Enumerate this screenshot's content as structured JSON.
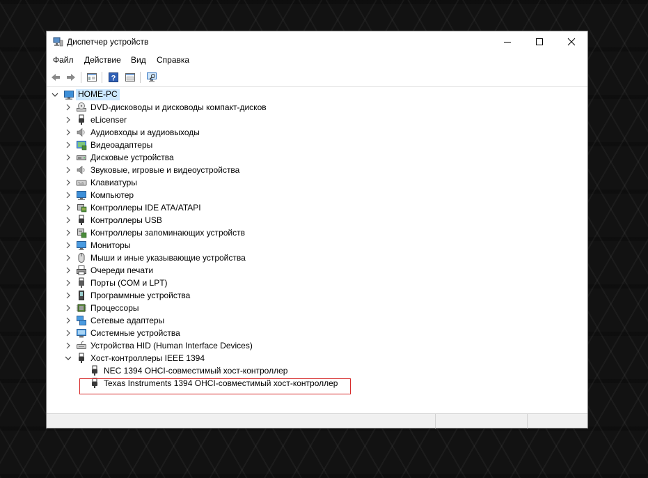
{
  "window": {
    "title": "Диспетчер устройств",
    "icon": "device-manager-icon"
  },
  "menu": [
    "Файл",
    "Действие",
    "Вид",
    "Справка"
  ],
  "toolbar": {
    "buttons": [
      "back-arrow-icon",
      "forward-arrow-icon",
      "properties-view-icon",
      "help-icon",
      "show-hide-panel-icon",
      "scan-hardware-icon"
    ]
  },
  "tree": {
    "root": "HOME-PC",
    "categories": [
      {
        "label": "DVD-дисководы и дисководы компакт-дисков",
        "icon": "optical-drive-icon"
      },
      {
        "label": "eLicenser",
        "icon": "usb-plug-icon"
      },
      {
        "label": "Аудиовходы и аудиовыходы",
        "icon": "speaker-icon"
      },
      {
        "label": "Видеоадаптеры",
        "icon": "display-adapter-icon"
      },
      {
        "label": "Дисковые устройства",
        "icon": "disk-drive-icon"
      },
      {
        "label": "Звуковые, игровые и видеоустройства",
        "icon": "speaker-icon"
      },
      {
        "label": "Клавиатуры",
        "icon": "keyboard-icon"
      },
      {
        "label": "Компьютер",
        "icon": "computer-icon"
      },
      {
        "label": "Контроллеры IDE ATA/ATAPI",
        "icon": "ide-controller-icon"
      },
      {
        "label": "Контроллеры USB",
        "icon": "usb-plug-icon"
      },
      {
        "label": "Контроллеры запоминающих устройств",
        "icon": "storage-controller-icon"
      },
      {
        "label": "Мониторы",
        "icon": "monitor-icon"
      },
      {
        "label": "Мыши и иные указывающие устройства",
        "icon": "mouse-icon"
      },
      {
        "label": "Очереди печати",
        "icon": "printer-icon"
      },
      {
        "label": "Порты (COM и LPT)",
        "icon": "port-icon"
      },
      {
        "label": "Программные устройства",
        "icon": "software-device-icon"
      },
      {
        "label": "Процессоры",
        "icon": "processor-icon"
      },
      {
        "label": "Сетевые адаптеры",
        "icon": "network-adapter-icon"
      },
      {
        "label": "Системные устройства",
        "icon": "system-device-icon"
      },
      {
        "label": "Устройства HID (Human Interface Devices)",
        "icon": "hid-icon"
      },
      {
        "label": "Хост-контроллеры IEEE 1394",
        "icon": "usb-plug-icon",
        "expanded": true
      }
    ],
    "children": [
      {
        "label": "NEC 1394 OHCI-совместимый хост-контроллер",
        "icon": "usb-plug-icon"
      },
      {
        "label": "Texas Instruments 1394 OHCI-совместимый хост-контроллер",
        "icon": "usb-plug-icon",
        "highlighted": true
      }
    ]
  },
  "colors": {
    "selection": "#cce8ff",
    "highlight_border": "#d62828"
  }
}
